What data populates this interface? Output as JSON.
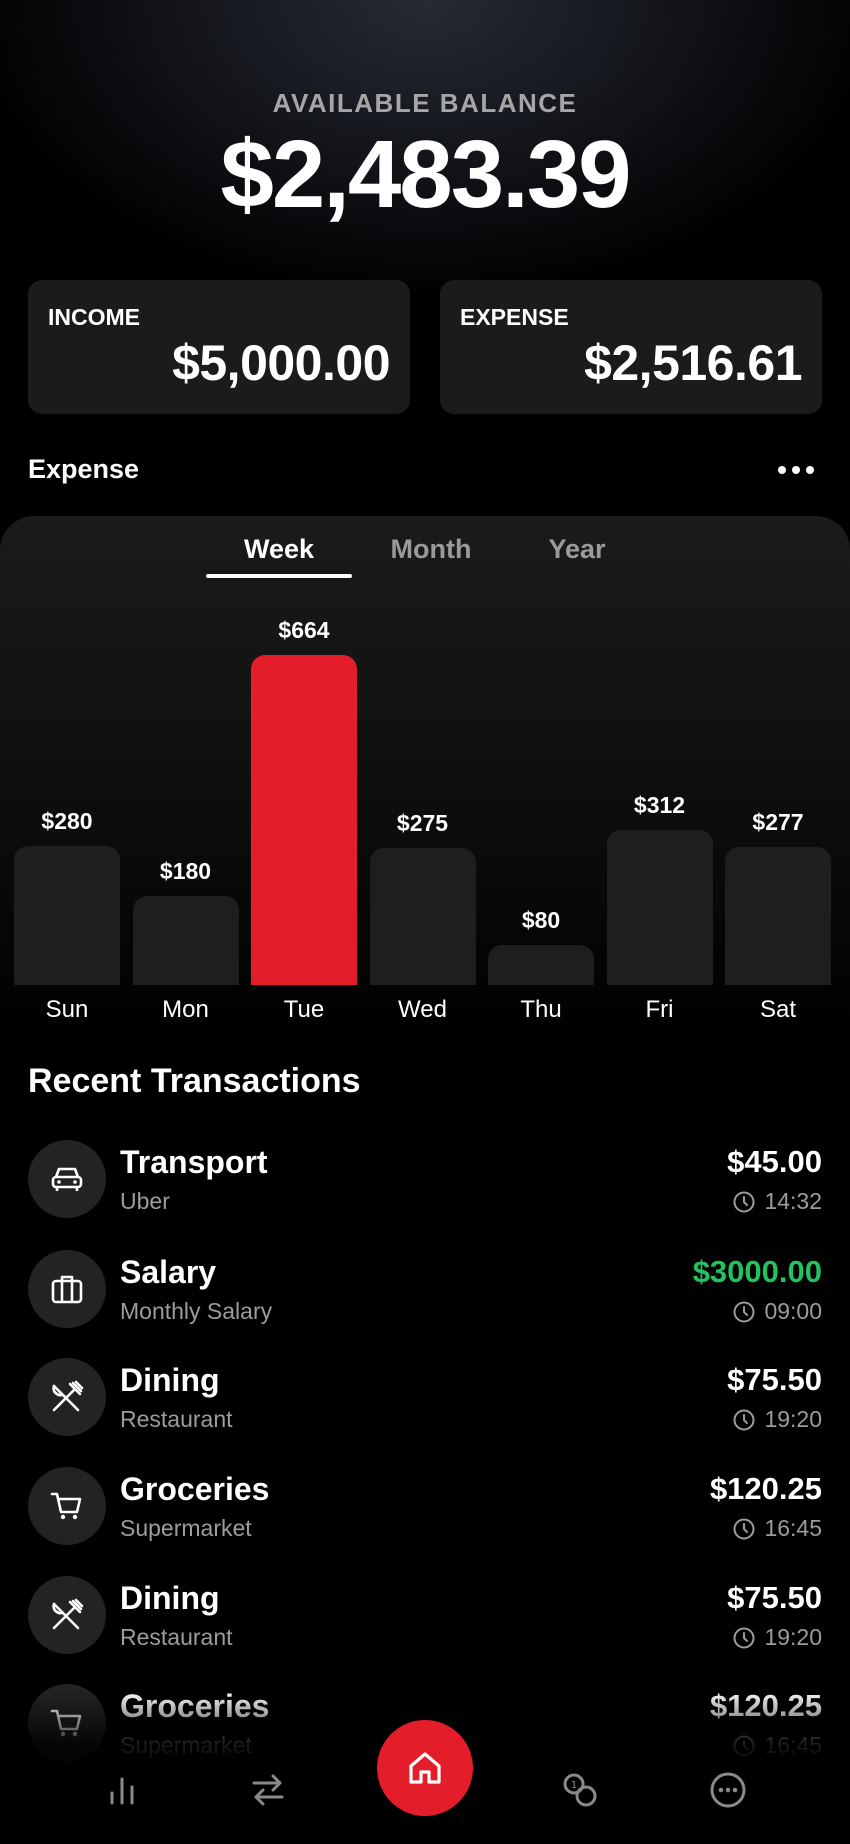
{
  "balance": {
    "label": "AVAILABLE BALANCE",
    "value": "$2,483.39"
  },
  "income": {
    "label": "INCOME",
    "value": "$5,000.00"
  },
  "expense_card": {
    "label": "EXPENSE",
    "value": "$2,516.61"
  },
  "expense_section": {
    "title": "Expense",
    "more_icon": "more-horizontal-icon"
  },
  "tabs": [
    {
      "label": "Week",
      "active": true
    },
    {
      "label": "Month",
      "active": false
    },
    {
      "label": "Year",
      "active": false
    }
  ],
  "chart_data": {
    "type": "bar",
    "categories": [
      "Sun",
      "Mon",
      "Tue",
      "Wed",
      "Thu",
      "Fri",
      "Sat"
    ],
    "values": [
      280,
      180,
      664,
      275,
      80,
      312,
      277
    ],
    "value_labels": [
      "$280",
      "$180",
      "$664",
      "$275",
      "$80",
      "$312",
      "$277"
    ],
    "highlighted": "Tue",
    "colors": {
      "bar": "#1e1e1e",
      "highlight": "#e31e2a"
    },
    "grid": false
  },
  "recent": {
    "title": "Recent Transactions",
    "items": [
      {
        "icon": "car-icon",
        "name": "Transport",
        "sub": "Uber",
        "amount": "$45.00",
        "time": "14:32",
        "positive": false
      },
      {
        "icon": "briefcase-icon",
        "name": "Salary",
        "sub": "Monthly Salary",
        "amount": "$3000.00",
        "time": "09:00",
        "positive": true
      },
      {
        "icon": "utensils-icon",
        "name": "Dining",
        "sub": "Restaurant",
        "amount": "$75.50",
        "time": "19:20",
        "positive": false
      },
      {
        "icon": "cart-icon",
        "name": "Groceries",
        "sub": "Supermarket",
        "amount": "$120.25",
        "time": "16:45",
        "positive": false
      },
      {
        "icon": "utensils-icon",
        "name": "Dining",
        "sub": "Restaurant",
        "amount": "$75.50",
        "time": "19:20",
        "positive": false
      },
      {
        "icon": "cart-icon",
        "name": "Groceries",
        "sub": "Supermarket",
        "amount": "$120.25",
        "time": "16:45",
        "positive": false
      }
    ]
  },
  "nav": [
    "stats-icon",
    "transfer-icon",
    "home-icon",
    "coins-icon",
    "more-circle-icon"
  ],
  "colors": {
    "accent": "#e31e2a",
    "positive": "#22c35e",
    "card": "#1b1b1b"
  }
}
